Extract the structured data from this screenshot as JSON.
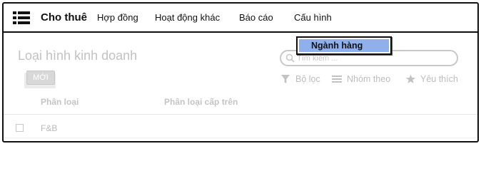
{
  "app": {
    "brand": "Cho thuê"
  },
  "nav": {
    "items": [
      {
        "label": "Hợp đồng"
      },
      {
        "label": "Hoạt động khác"
      },
      {
        "label": "Báo cáo"
      },
      {
        "label": "Cấu hình"
      }
    ]
  },
  "dropdown": {
    "items": [
      {
        "label": "Ngành hàng",
        "active": true
      }
    ]
  },
  "page": {
    "title": "Loại hình kinh doanh",
    "new_label": "MỚI"
  },
  "search": {
    "placeholder": "Tìm kiếm ..."
  },
  "options": {
    "filter": "Bộ lọc",
    "group": "Nhóm theo",
    "favorite": "Yêu thích"
  },
  "table": {
    "columns": [
      "Phân loại",
      "Phân loại cấp trên"
    ],
    "rows": [
      {
        "name": "F&B",
        "parent": ""
      }
    ]
  },
  "colors": {
    "accent": "#8fb0ea",
    "border": "#111111",
    "muted": "#c2c2c2"
  },
  "icons": {
    "menu": "hamburger-list-icon",
    "search": "magnifier-icon",
    "filter": "funnel-icon",
    "group": "lines-icon",
    "favorite": "star-icon"
  }
}
